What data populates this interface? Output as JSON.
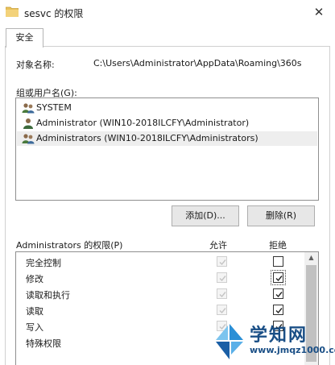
{
  "window": {
    "title": "sesvc 的权限",
    "close_glyph": "✕"
  },
  "tabs": [
    {
      "label": "安全"
    }
  ],
  "object": {
    "label": "对象名称:",
    "value": "C:\\Users\\Administrator\\AppData\\Roaming\\360s"
  },
  "groups": {
    "label": "组或用户名(G):",
    "items": [
      {
        "label": "SYSTEM",
        "icon": "users-group-icon",
        "selected": false
      },
      {
        "label": "Administrator (WIN10-2018ILCFY\\Administrator)",
        "icon": "user-icon",
        "selected": false
      },
      {
        "label": "Administrators (WIN10-2018ILCFY\\Administrators)",
        "icon": "users-group-icon",
        "selected": true
      }
    ]
  },
  "buttons": {
    "add": "添加(D)...",
    "remove": "删除(R)"
  },
  "permissions": {
    "label": "Administrators 的权限(P)",
    "allow_header": "允许",
    "deny_header": "拒绝",
    "rows": [
      {
        "name": "完全控制",
        "allow": true,
        "deny": false
      },
      {
        "name": "修改",
        "allow": true,
        "deny": true
      },
      {
        "name": "读取和执行",
        "allow": true,
        "deny": true
      },
      {
        "name": "读取",
        "allow": true,
        "deny": true
      },
      {
        "name": "写入",
        "allow": true,
        "deny": true
      },
      {
        "name": "特殊权限",
        "allow": false,
        "deny": false
      }
    ]
  },
  "watermark": {
    "name": "学知网",
    "url": "www.jmqz1000.com"
  },
  "colors": {
    "accent": "#1a4f86",
    "folder": "#e8c15a",
    "watermark_blue": "#2a8fd6"
  }
}
